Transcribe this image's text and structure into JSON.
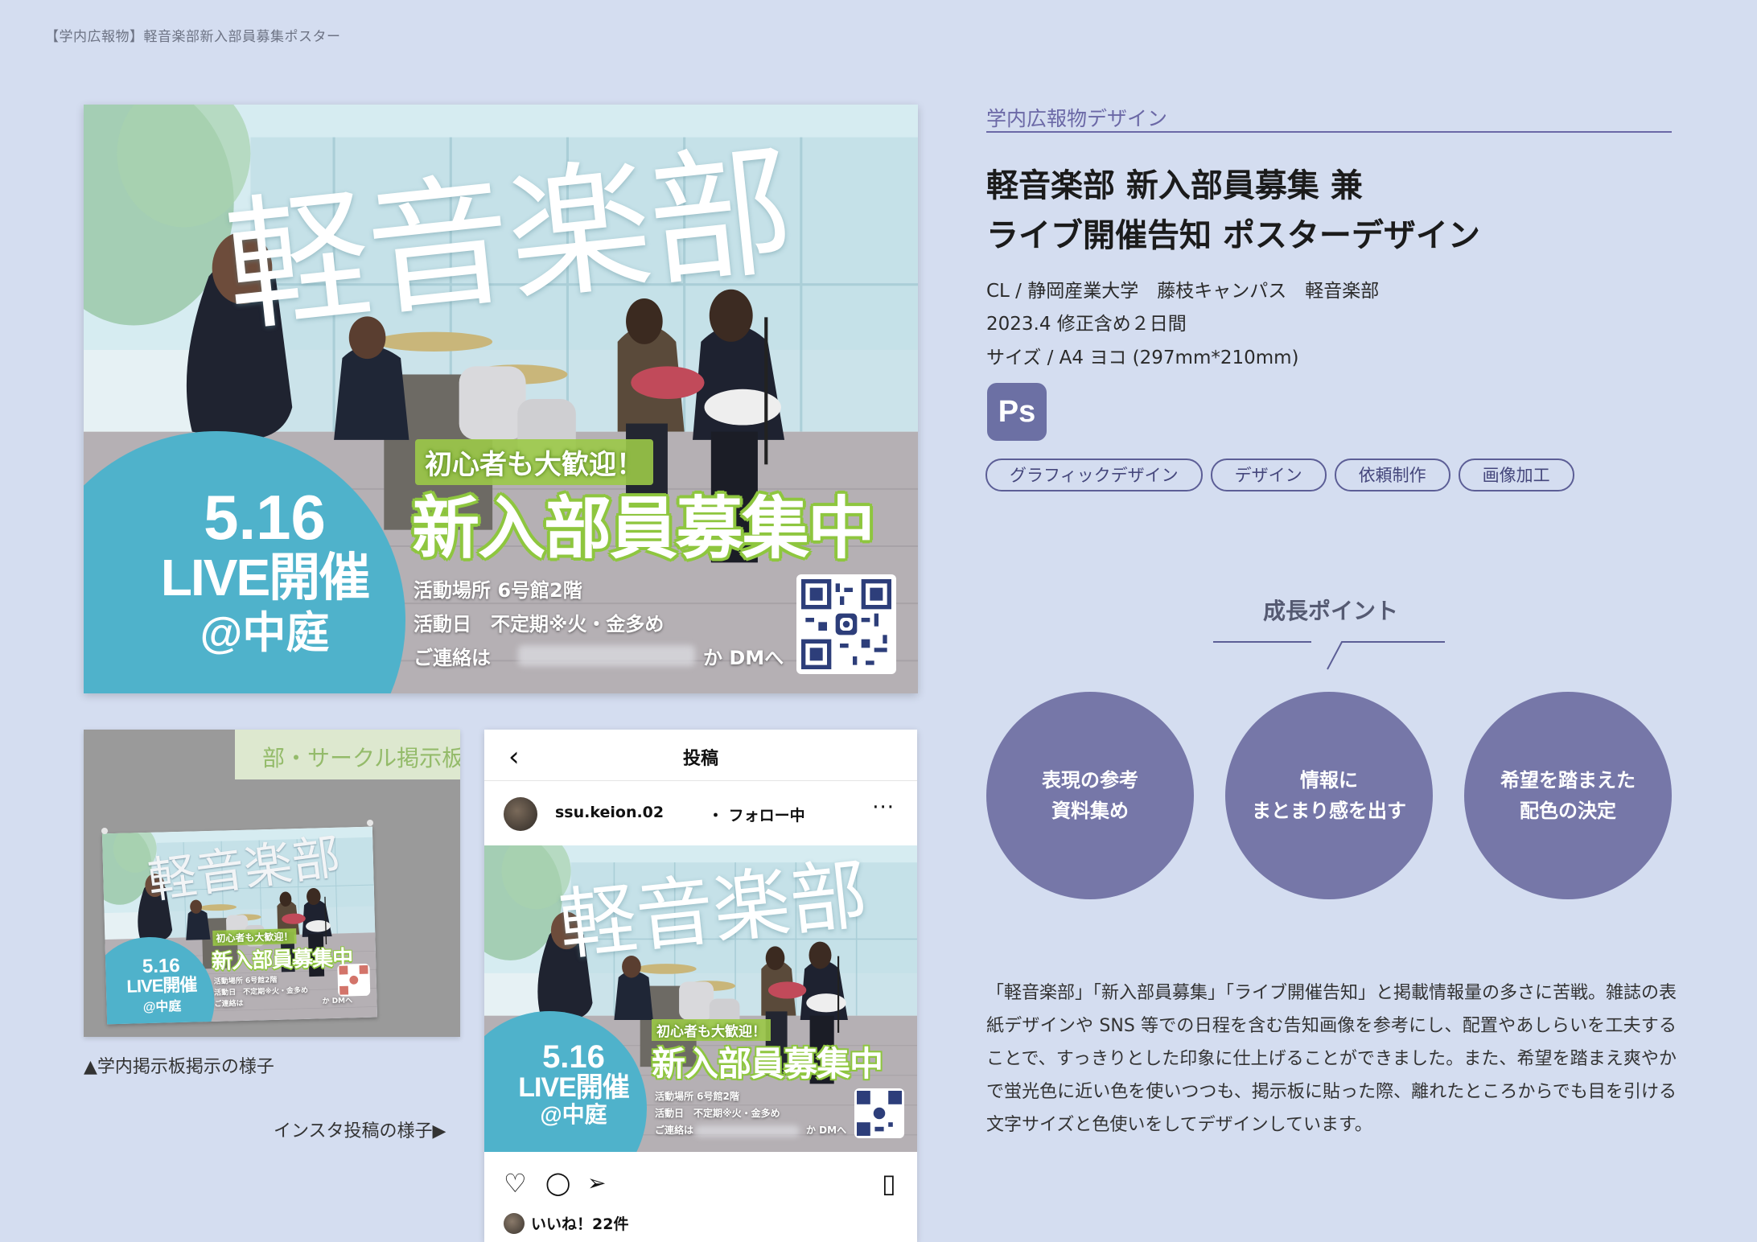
{
  "header": {
    "label": "【学内広報物】軽音楽部新入部員募集ポスター"
  },
  "poster": {
    "title": "軽音楽部",
    "live_date": "5.16",
    "live_text": "LIVE開催",
    "live_place": "@中庭",
    "welcome": "初心者も大歓迎！",
    "recruit": "新入部員募集中",
    "info_place": "活動場所 6号館2階",
    "info_days": "活動日　不定期※火・金多め",
    "info_contact": "ご連絡は",
    "info_dm": "か DMへ"
  },
  "bulletin": {
    "board_label": "部・サークル掲示板",
    "caption": "▲学内掲示板掲示の様子"
  },
  "insta": {
    "caption": "インスタ投稿の様子▶",
    "back_icon": "‹",
    "title": "投稿",
    "username": "ssu.keion.02",
    "follow": "・ フォロー中",
    "more_icon": "···",
    "icons": {
      "like": "♡",
      "comment": "◯",
      "share": "➢",
      "save": "▯"
    },
    "likes": "いいね！22件"
  },
  "info": {
    "category": "学内広報物デザイン",
    "title_line1": "軽音楽部 新入部員募集 兼",
    "title_line2": "ライブ開催告知 ポスターデザイン",
    "client": "CL / 静岡産業大学　藤枝キャンパス　軽音楽部",
    "period": "2023.4  修正含め２日間",
    "size": "サイズ / A4 ヨコ (297mm*210mm)",
    "tool": "Ps",
    "tags": [
      "グラフィックデザイン",
      "デザイン",
      "依頼制作",
      "画像加工"
    ]
  },
  "growth": {
    "title": "成長ポイント",
    "points": [
      {
        "line1": "表現の参考",
        "line2": "資料集め"
      },
      {
        "line1": "情報に",
        "line2": "まとまり感を出す"
      },
      {
        "line1": "希望を踏まえた",
        "line2": "配色の決定"
      }
    ]
  },
  "description": "「軽音楽部」「新入部員募集」「ライブ開催告知」と掲載情報量の多さに苦戦。雑誌の表紙デザインや SNS 等での日程を含む告知画像を参考にし、配置やあしらいを工夫することで、すっきりとした印象に仕上げることができました。また、希望を踏まえ爽やかで蛍光色に近い色を使いつつも、掲示板に貼った際、離れたところからでも目を引ける文字サイズと色使いをしてデザインしています。",
  "colors": {
    "background": "#d4ddf0",
    "accent": "#6b68a6",
    "circle": "#7677a8",
    "live_blue": "#4fb2cb",
    "recruit_green": "#8ec63f"
  }
}
